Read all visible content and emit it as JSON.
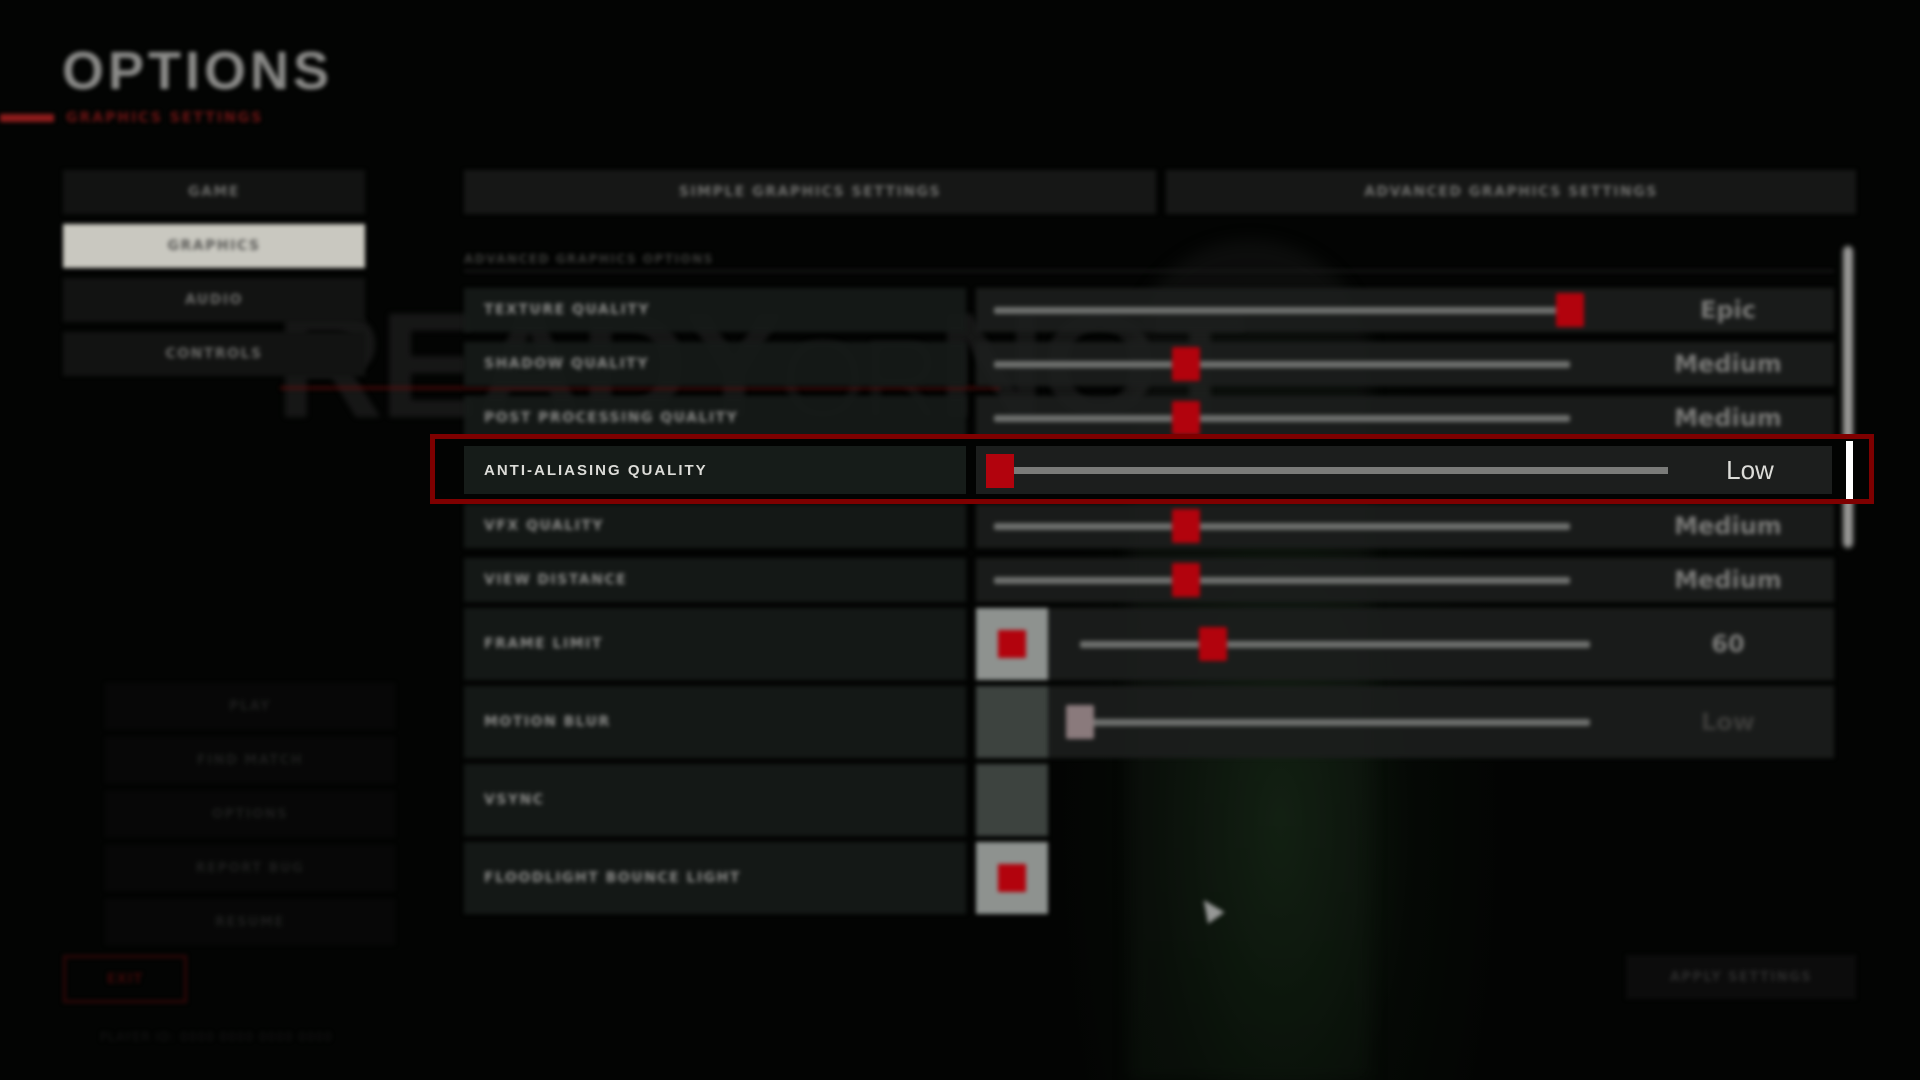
{
  "header": {
    "title": "OPTIONS",
    "subtitle": "GRAPHICS SETTINGS"
  },
  "background": {
    "logo_left": "READY",
    "logo_mid": "OR",
    "logo_right": "NOT"
  },
  "nav": {
    "items": [
      {
        "label": "GAME",
        "active": false
      },
      {
        "label": "GRAPHICS",
        "active": true
      },
      {
        "label": "AUDIO",
        "active": false
      },
      {
        "label": "CONTROLS",
        "active": false
      }
    ]
  },
  "pause_menu": {
    "items": [
      "PLAY",
      "FIND MATCH",
      "OPTIONS",
      "REPORT BUG",
      "RESUME"
    ]
  },
  "exit_label": "EXIT",
  "footer_note": "PLAYER ID: 0000 0000 0000 0000",
  "apply_label": "APPLY SETTINGS",
  "tabs": {
    "simple": "SIMPLE GRAPHICS SETTINGS",
    "advanced": "ADVANCED GRAPHICS SETTINGS"
  },
  "section_label": "ADVANCED GRAPHICS OPTIONS",
  "colors": {
    "accent_red": "#b2030d",
    "highlight_border": "#7e0000"
  },
  "settings": [
    {
      "label": "TEXTURE QUALITY",
      "type": "slider",
      "value": "Epic",
      "position": 1.0
    },
    {
      "label": "SHADOW QUALITY",
      "type": "slider",
      "value": "Medium",
      "position": 0.333
    },
    {
      "label": "POST PROCESSING QUALITY",
      "type": "slider",
      "value": "Medium",
      "position": 0.333
    },
    {
      "label": "ANTI-ALIASING QUALITY",
      "type": "slider",
      "value": "Low",
      "position": 0.0,
      "highlighted": true
    },
    {
      "label": "VFX QUALITY",
      "type": "slider",
      "value": "Medium",
      "position": 0.333
    },
    {
      "label": "VIEW DISTANCE",
      "type": "slider",
      "value": "Medium",
      "position": 0.333
    },
    {
      "label": "FRAME LIMIT",
      "type": "checkbox-slider",
      "checked": true,
      "value": "60",
      "position": 0.26
    },
    {
      "label": "MOTION BLUR",
      "type": "checkbox-slider",
      "checked": false,
      "value": "Low",
      "position": 0.0,
      "disabled": true
    },
    {
      "label": "VSYNC",
      "type": "checkbox",
      "checked": false
    },
    {
      "label": "FLOODLIGHT BOUNCE LIGHT",
      "type": "checkbox",
      "checked": true
    }
  ]
}
